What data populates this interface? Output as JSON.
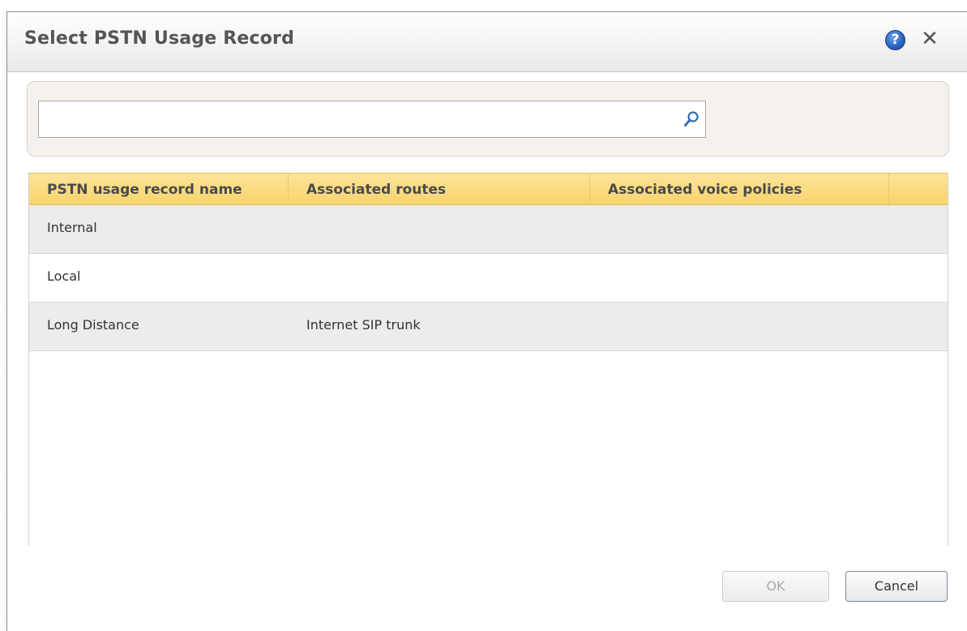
{
  "dialog": {
    "title": "Select PSTN Usage Record",
    "help_icon": "help-icon",
    "help_glyph": "?",
    "close_icon": "close-icon",
    "close_glyph": "✕"
  },
  "search": {
    "value": "",
    "placeholder": "",
    "icon": "search-icon"
  },
  "grid": {
    "columns": [
      "PSTN usage record name",
      "Associated routes",
      "Associated voice policies",
      ""
    ],
    "rows": [
      {
        "name": "Internal",
        "routes": "",
        "policies": ""
      },
      {
        "name": "Local",
        "routes": "",
        "policies": ""
      },
      {
        "name": "Long Distance",
        "routes": "Internet SIP trunk",
        "policies": ""
      }
    ],
    "header_color": "#f8d46c"
  },
  "buttons": {
    "ok_label": "OK",
    "ok_enabled": false,
    "cancel_label": "Cancel"
  }
}
